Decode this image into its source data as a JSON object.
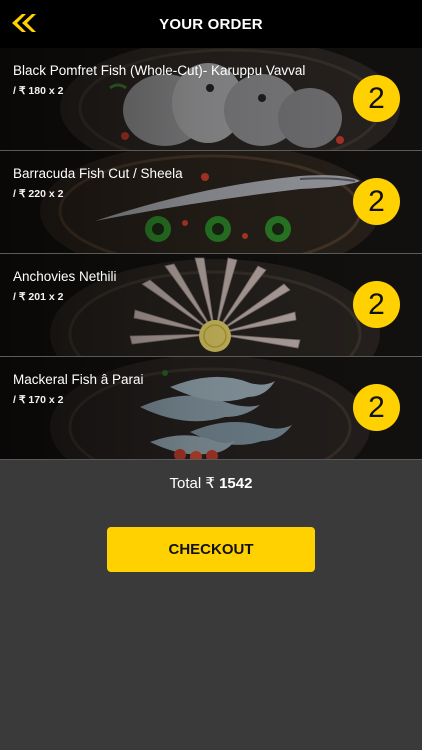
{
  "header": {
    "title": "YOUR ORDER",
    "back_icon": "double-chevron-left-icon",
    "accent": "#ffd100"
  },
  "items": [
    {
      "name": "Black Pomfret Fish (Whole-Cut)- Karuppu Vavval",
      "price": "/ ₹ 180 x 2",
      "qty": "2"
    },
    {
      "name": "Barracuda Fish Cut / Sheela",
      "price": "/ ₹ 220 x 2",
      "qty": "2"
    },
    {
      "name": "Anchovies Nethili",
      "price": "/ ₹ 201 x 2",
      "qty": "2"
    },
    {
      "name": "Mackeral Fish â Parai",
      "price": "/ ₹ 170 x 2",
      "qty": "2"
    }
  ],
  "total": {
    "label": "Total ₹",
    "amount": "1542"
  },
  "checkout": {
    "label": "CHECKOUT"
  },
  "colors": {
    "background": "#3a3a3a",
    "header_bg": "#000000",
    "accent": "#ffd100"
  }
}
